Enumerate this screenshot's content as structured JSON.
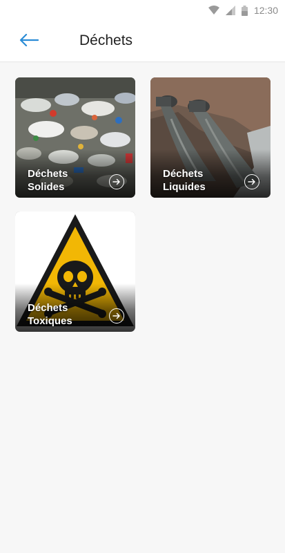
{
  "status_bar": {
    "time": "12:30",
    "icons": [
      "wifi-icon",
      "cell-signal-icon",
      "battery-icon"
    ]
  },
  "header": {
    "back_icon": "arrow-left-icon",
    "title": "Déchets"
  },
  "categories": [
    {
      "line1": "Déchets",
      "line2": "Solides",
      "icon": "arrow-right-circle-icon"
    },
    {
      "line1": "Déchets",
      "line2": "Liquides",
      "icon": "arrow-right-circle-icon"
    },
    {
      "line1": "Déchets",
      "line2": "Toxiques",
      "icon": "arrow-right-circle-icon"
    }
  ],
  "colors": {
    "accent": "#2a8bd6",
    "background": "#f7f7f7",
    "appbar": "#ffffff",
    "warning_yellow": "#f2b705"
  }
}
